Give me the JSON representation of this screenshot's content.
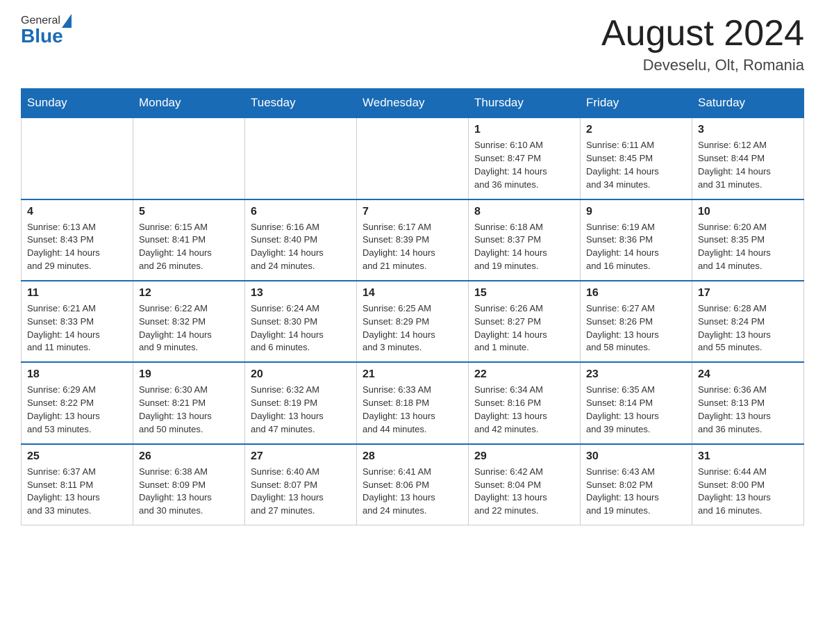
{
  "header": {
    "logo_general": "General",
    "logo_blue": "Blue",
    "month_title": "August 2024",
    "location": "Deveselu, Olt, Romania"
  },
  "days_of_week": [
    "Sunday",
    "Monday",
    "Tuesday",
    "Wednesday",
    "Thursday",
    "Friday",
    "Saturday"
  ],
  "weeks": [
    [
      {
        "day": "",
        "info": ""
      },
      {
        "day": "",
        "info": ""
      },
      {
        "day": "",
        "info": ""
      },
      {
        "day": "",
        "info": ""
      },
      {
        "day": "1",
        "info": "Sunrise: 6:10 AM\nSunset: 8:47 PM\nDaylight: 14 hours\nand 36 minutes."
      },
      {
        "day": "2",
        "info": "Sunrise: 6:11 AM\nSunset: 8:45 PM\nDaylight: 14 hours\nand 34 minutes."
      },
      {
        "day": "3",
        "info": "Sunrise: 6:12 AM\nSunset: 8:44 PM\nDaylight: 14 hours\nand 31 minutes."
      }
    ],
    [
      {
        "day": "4",
        "info": "Sunrise: 6:13 AM\nSunset: 8:43 PM\nDaylight: 14 hours\nand 29 minutes."
      },
      {
        "day": "5",
        "info": "Sunrise: 6:15 AM\nSunset: 8:41 PM\nDaylight: 14 hours\nand 26 minutes."
      },
      {
        "day": "6",
        "info": "Sunrise: 6:16 AM\nSunset: 8:40 PM\nDaylight: 14 hours\nand 24 minutes."
      },
      {
        "day": "7",
        "info": "Sunrise: 6:17 AM\nSunset: 8:39 PM\nDaylight: 14 hours\nand 21 minutes."
      },
      {
        "day": "8",
        "info": "Sunrise: 6:18 AM\nSunset: 8:37 PM\nDaylight: 14 hours\nand 19 minutes."
      },
      {
        "day": "9",
        "info": "Sunrise: 6:19 AM\nSunset: 8:36 PM\nDaylight: 14 hours\nand 16 minutes."
      },
      {
        "day": "10",
        "info": "Sunrise: 6:20 AM\nSunset: 8:35 PM\nDaylight: 14 hours\nand 14 minutes."
      }
    ],
    [
      {
        "day": "11",
        "info": "Sunrise: 6:21 AM\nSunset: 8:33 PM\nDaylight: 14 hours\nand 11 minutes."
      },
      {
        "day": "12",
        "info": "Sunrise: 6:22 AM\nSunset: 8:32 PM\nDaylight: 14 hours\nand 9 minutes."
      },
      {
        "day": "13",
        "info": "Sunrise: 6:24 AM\nSunset: 8:30 PM\nDaylight: 14 hours\nand 6 minutes."
      },
      {
        "day": "14",
        "info": "Sunrise: 6:25 AM\nSunset: 8:29 PM\nDaylight: 14 hours\nand 3 minutes."
      },
      {
        "day": "15",
        "info": "Sunrise: 6:26 AM\nSunset: 8:27 PM\nDaylight: 14 hours\nand 1 minute."
      },
      {
        "day": "16",
        "info": "Sunrise: 6:27 AM\nSunset: 8:26 PM\nDaylight: 13 hours\nand 58 minutes."
      },
      {
        "day": "17",
        "info": "Sunrise: 6:28 AM\nSunset: 8:24 PM\nDaylight: 13 hours\nand 55 minutes."
      }
    ],
    [
      {
        "day": "18",
        "info": "Sunrise: 6:29 AM\nSunset: 8:22 PM\nDaylight: 13 hours\nand 53 minutes."
      },
      {
        "day": "19",
        "info": "Sunrise: 6:30 AM\nSunset: 8:21 PM\nDaylight: 13 hours\nand 50 minutes."
      },
      {
        "day": "20",
        "info": "Sunrise: 6:32 AM\nSunset: 8:19 PM\nDaylight: 13 hours\nand 47 minutes."
      },
      {
        "day": "21",
        "info": "Sunrise: 6:33 AM\nSunset: 8:18 PM\nDaylight: 13 hours\nand 44 minutes."
      },
      {
        "day": "22",
        "info": "Sunrise: 6:34 AM\nSunset: 8:16 PM\nDaylight: 13 hours\nand 42 minutes."
      },
      {
        "day": "23",
        "info": "Sunrise: 6:35 AM\nSunset: 8:14 PM\nDaylight: 13 hours\nand 39 minutes."
      },
      {
        "day": "24",
        "info": "Sunrise: 6:36 AM\nSunset: 8:13 PM\nDaylight: 13 hours\nand 36 minutes."
      }
    ],
    [
      {
        "day": "25",
        "info": "Sunrise: 6:37 AM\nSunset: 8:11 PM\nDaylight: 13 hours\nand 33 minutes."
      },
      {
        "day": "26",
        "info": "Sunrise: 6:38 AM\nSunset: 8:09 PM\nDaylight: 13 hours\nand 30 minutes."
      },
      {
        "day": "27",
        "info": "Sunrise: 6:40 AM\nSunset: 8:07 PM\nDaylight: 13 hours\nand 27 minutes."
      },
      {
        "day": "28",
        "info": "Sunrise: 6:41 AM\nSunset: 8:06 PM\nDaylight: 13 hours\nand 24 minutes."
      },
      {
        "day": "29",
        "info": "Sunrise: 6:42 AM\nSunset: 8:04 PM\nDaylight: 13 hours\nand 22 minutes."
      },
      {
        "day": "30",
        "info": "Sunrise: 6:43 AM\nSunset: 8:02 PM\nDaylight: 13 hours\nand 19 minutes."
      },
      {
        "day": "31",
        "info": "Sunrise: 6:44 AM\nSunset: 8:00 PM\nDaylight: 13 hours\nand 16 minutes."
      }
    ]
  ]
}
